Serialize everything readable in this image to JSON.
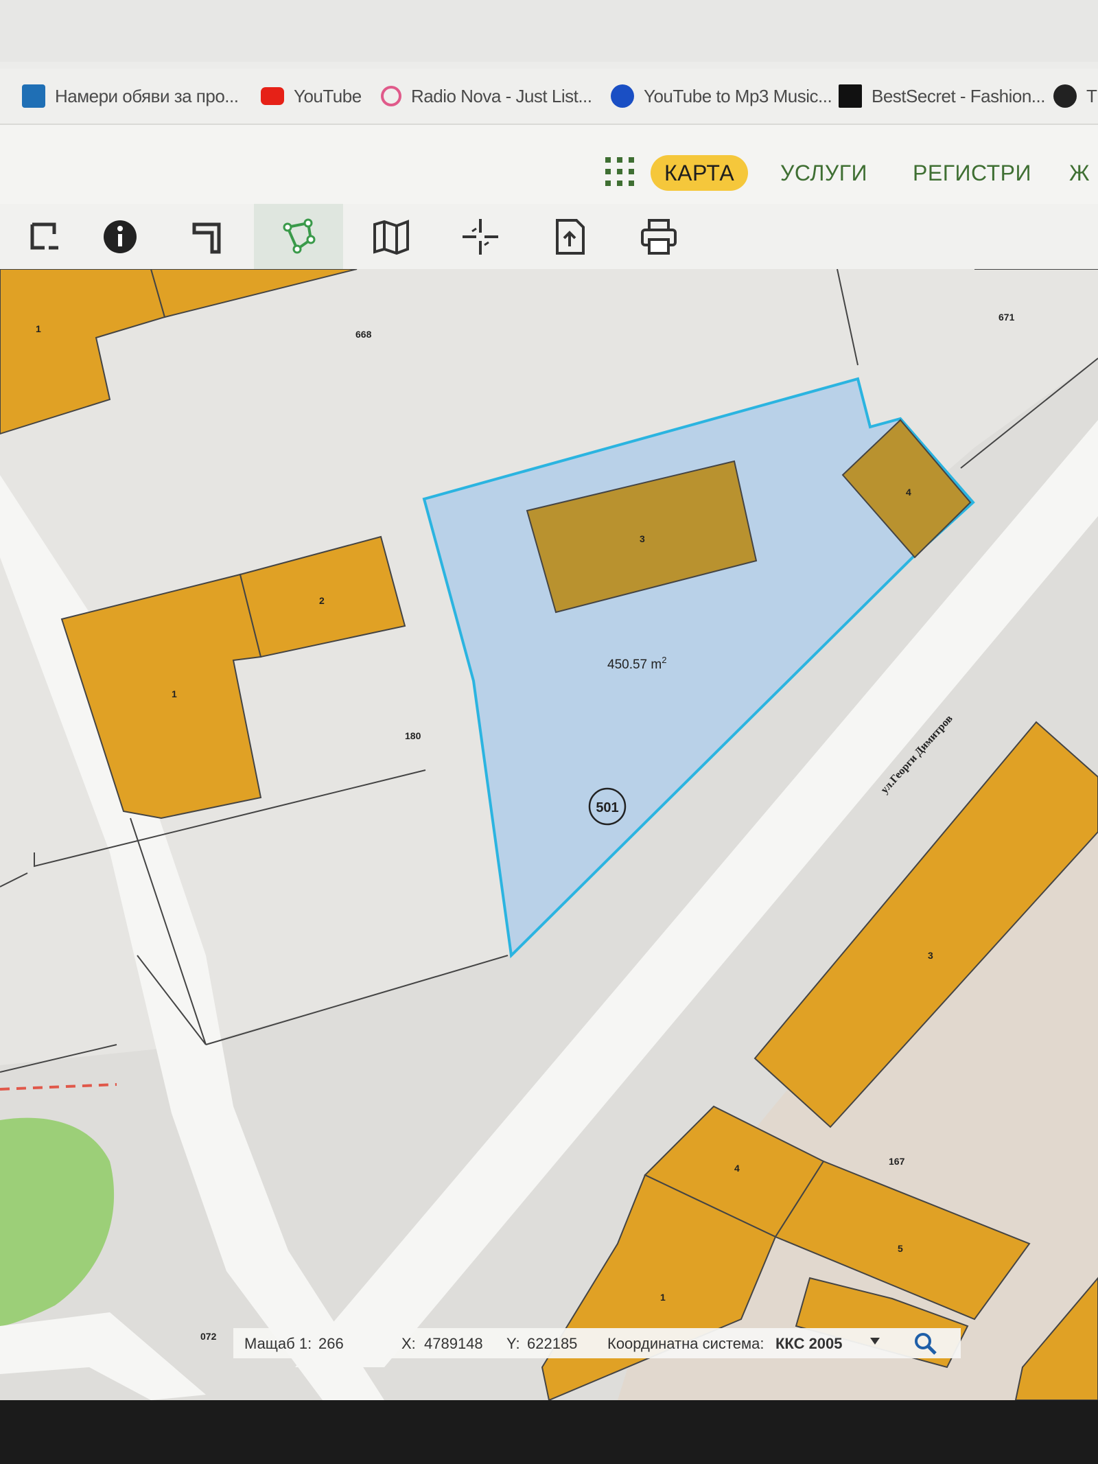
{
  "bookmarks": [
    {
      "label": "Намери обяви за про...",
      "icon": "listing-site-icon",
      "color": "#1f6fb5"
    },
    {
      "label": "YouTube",
      "icon": "youtube-icon",
      "color": "#e62117"
    },
    {
      "label": "Radio Nova - Just List...",
      "icon": "radio-icon",
      "color": "#e05a8a"
    },
    {
      "label": "YouTube to Mp3 Music...",
      "icon": "converter-icon",
      "color": "#1a4fc4"
    },
    {
      "label": "BestSecret - Fashion...",
      "icon": "bestsecret-icon",
      "color": "#111111"
    },
    {
      "label": "T",
      "icon": "globe-icon",
      "color": "#222222"
    }
  ],
  "nav": {
    "apps_icon": "apps-grid-icon",
    "items": [
      "КАРТА",
      "УСЛУГИ",
      "РЕГИСТРИ",
      "Ж"
    ],
    "active": "КАРТА"
  },
  "toolbar": {
    "tools": [
      {
        "name": "select-area-icon"
      },
      {
        "name": "info-icon"
      },
      {
        "name": "measure-icon"
      },
      {
        "name": "polygon-draw-icon",
        "active": true
      },
      {
        "name": "map-layers-icon"
      },
      {
        "name": "crosshair-icon"
      },
      {
        "name": "export-icon"
      },
      {
        "name": "print-icon"
      }
    ]
  },
  "map": {
    "selected_parcel_number": "501",
    "selected_area_value": "450.57 m",
    "selected_area_exp": "2",
    "street_name": "ул.Георги Димитров",
    "parcel_labels": {
      "p668": "668",
      "p671": "671",
      "p180": "180",
      "p167": "167",
      "p072": "072"
    },
    "building_labels": {
      "b_a1": "1",
      "b_a2": "2",
      "b_a1b": "1",
      "b_s3": "3",
      "b_s4": "4",
      "b_r3": "3",
      "b_r4": "4",
      "b_r5": "5",
      "b_r1": "1"
    },
    "colors": {
      "building": "#e0a125",
      "selected_fill": "#b9d1e8",
      "selected_stroke": "#2bb4e0",
      "selected_building": "#b9922f",
      "road": "#f6f6f4",
      "green": "#9ccf78"
    }
  },
  "status": {
    "scale_label": "Мащаб 1:",
    "scale_value": "266",
    "x_label": "X:",
    "x_value": "4789148",
    "y_label": "Y:",
    "y_value": "622185",
    "crs_label": "Координатна система:",
    "crs_value": "ККС 2005"
  }
}
